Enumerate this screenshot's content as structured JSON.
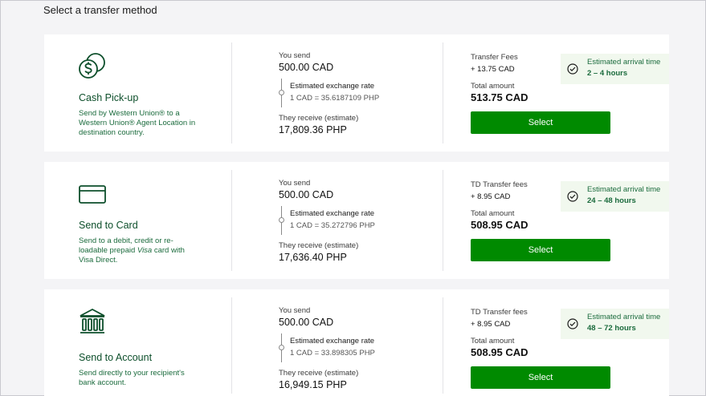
{
  "page": {
    "title": "Select a transfer method"
  },
  "colors": {
    "brand_green": "#008a00",
    "dark_green": "#0d4f2b",
    "arrival_bg": "#f1f8ee"
  },
  "options": [
    {
      "icon": "coins-icon",
      "name": "Cash Pick-up",
      "desc": "Send by Western Union® to a Western Union® Agent Location in destination country.",
      "send_label": "You send",
      "send_amount": "500.00 CAD",
      "rate_label": "Estimated exchange rate",
      "rate_value": "1 CAD = 35.6187109 PHP",
      "receive_label": "They receive (estimate)",
      "receive_amount": "17,809.36 PHP",
      "fee_label": "Transfer Fees",
      "fee_value": "+ 13.75 CAD",
      "total_label": "Total amount",
      "total_value": "513.75 CAD",
      "button": "Select",
      "arrival_label": "Estimated arrival time",
      "arrival_value": "2 – 4 hours"
    },
    {
      "icon": "credit-card-icon",
      "name": "Send to Card",
      "desc_parts": [
        "Send to a debit, credit or re-loadable prepaid ",
        "Visa",
        " card with Visa Direct."
      ],
      "send_label": "You send",
      "send_amount": "500.00 CAD",
      "rate_label": "Estimated exchange rate",
      "rate_value": "1 CAD = 35.272796 PHP",
      "receive_label": "They receive (estimate)",
      "receive_amount": "17,636.40 PHP",
      "fee_label": "TD Transfer fees",
      "fee_value": "+ 8.95 CAD",
      "total_label": "Total amount",
      "total_value": "508.95 CAD",
      "button": "Select",
      "arrival_label": "Estimated arrival time",
      "arrival_value": "24 – 48 hours"
    },
    {
      "icon": "bank-icon",
      "name": "Send to Account",
      "desc": "Send directly to your recipient's bank account.",
      "send_label": "You send",
      "send_amount": "500.00 CAD",
      "rate_label": "Estimated exchange rate",
      "rate_value": "1 CAD = 33.898305 PHP",
      "receive_label": "They receive (estimate)",
      "receive_amount": "16,949.15 PHP",
      "fee_label": "TD Transfer fees",
      "fee_value": "+ 8.95 CAD",
      "total_label": "Total amount",
      "total_value": "508.95 CAD",
      "button": "Select",
      "arrival_label": "Estimated arrival time",
      "arrival_value": "48 – 72 hours"
    }
  ]
}
